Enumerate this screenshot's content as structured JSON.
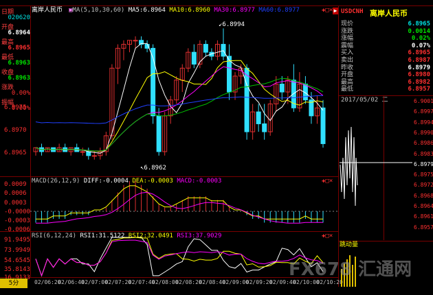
{
  "colors": {
    "up": "#e03030",
    "down": "#30e0ff",
    "ma5": "#ffffff",
    "ma10": "#ffff00",
    "ma20": "#ff00ff",
    "ma30": "#00c000",
    "ma60": "#2040ff",
    "border": "#a00000",
    "yellow": "#ffff00",
    "white": "#ffffff"
  },
  "window": {
    "title": "离岸人民币"
  },
  "ma_header": {
    "prefix": "MA(5,10,30,60)",
    "ma5": "MA5:6.8964",
    "ma10": "MA10:6.8960",
    "ma30": "MA30:6.8977",
    "ma60": "MA60:6.8977"
  },
  "left_panel": {
    "items": [
      {
        "label": "日期",
        "value": "020620"
      },
      {
        "label": "开盘",
        "value": "6.8964"
      },
      {
        "label": "最高",
        "value": "6.8965"
      },
      {
        "label": "最低",
        "value": "6.8963"
      },
      {
        "label": "收盘",
        "value": "6.8963"
      },
      {
        "label": "涨跌",
        "value": "0.00%"
      },
      {
        "label": "振幅",
        "value": "0.00%"
      }
    ]
  },
  "main_chart": {
    "price_ticks": [
      "6.8975",
      "6.8970",
      "6.8965"
    ],
    "annotations": {
      "high": "6.8994",
      "low": "6.8962"
    }
  },
  "macd": {
    "header": "MACD(26,12,9)",
    "diff": "DIFF:-0.0004",
    "dea": "DEA:-0.0003",
    "macd": "MACD:-0.0003",
    "ticks": [
      "0.0009",
      "0.0006",
      "0.0003",
      "-0.0000",
      "-0.0003",
      "-0.0006"
    ]
  },
  "rsi": {
    "header": "RSI(6,12,24)",
    "rsi1": "RSI1:31.5122",
    "rsi2": "RSI2:32.0491",
    "rsi3": "RSI3:37.9029",
    "ticks": [
      "91.9495",
      "73.9949",
      "54.6545",
      "35.8143",
      "16.9133"
    ]
  },
  "time_axis": {
    "period": "5分",
    "labels": [
      "02/06:20",
      "02/06:40",
      "02/07:00",
      "02/07:20",
      "02/07:40",
      "02/08:00",
      "02/08:20",
      "02/08:40",
      "02/09:00",
      "02/09:20",
      "02/09:40",
      "02/10:00",
      "02/10:20"
    ]
  },
  "quote_panel": {
    "symbol": "USDCNH",
    "name": "离岸人民币",
    "rows": [
      {
        "label": "现价",
        "value": "6.8965",
        "color": "#00e0e0"
      },
      {
        "label": "涨跌",
        "value": "0.0014",
        "color": "#00e000"
      },
      {
        "label": "涨幅",
        "value": "0.02%",
        "color": "#00e000"
      },
      {
        "label": "震幅",
        "value": "0.07%",
        "color": "#ffffff"
      },
      {
        "label": "买入",
        "value": "6.8965",
        "color": "#ff3030"
      },
      {
        "label": "卖出",
        "value": "6.8987",
        "color": "#ff3030"
      },
      {
        "label": "昨收",
        "value": "6.8979",
        "color": "#ffffff"
      },
      {
        "label": "开盘",
        "value": "6.8980",
        "color": "#ff3030"
      },
      {
        "label": "最高",
        "value": "6.8982",
        "color": "#ff3030"
      },
      {
        "label": "最低",
        "value": "6.8957",
        "color": "#ff3030"
      }
    ],
    "date": "2017/05/02 二",
    "mini_ticks": [
      "6.9001",
      "6.8997",
      "6.8994",
      "6.8990",
      "6.8986",
      "6.8983",
      "6.8979",
      "6.8975",
      "6.8972",
      "6.8968",
      "6.8964",
      "6.8961",
      "6.8957"
    ],
    "volume_label": "跳动量"
  },
  "watermark": "FX678 汇通网",
  "chart_data": {
    "type": "candlestick",
    "candles": [
      [
        6.8963,
        6.8964,
        6.8962,
        6.8964
      ],
      [
        6.8964,
        6.8965,
        6.8962,
        6.8963
      ],
      [
        6.8963,
        6.8964,
        6.8963,
        6.8964
      ],
      [
        6.8964,
        6.8964,
        6.8963,
        6.8963
      ],
      [
        6.8963,
        6.8965,
        6.8963,
        6.8964
      ],
      [
        6.8964,
        6.8965,
        6.8963,
        6.8963
      ],
      [
        6.8963,
        6.8964,
        6.8962,
        6.8964
      ],
      [
        6.8964,
        6.8965,
        6.8963,
        6.8963
      ],
      [
        6.8963,
        6.8964,
        6.8962,
        6.8963
      ],
      [
        6.8963,
        6.8964,
        6.8961,
        6.8962
      ],
      [
        6.8962,
        6.8963,
        6.8961,
        6.8962
      ],
      [
        6.8962,
        6.8964,
        6.8961,
        6.8963
      ],
      [
        6.8963,
        6.8968,
        6.8962,
        6.8967
      ],
      [
        6.8967,
        6.8985,
        6.8966,
        6.8984
      ],
      [
        6.8984,
        6.899,
        6.898,
        6.8989
      ],
      [
        6.8989,
        6.8991,
        6.8986,
        6.899
      ],
      [
        6.899,
        6.8991,
        6.8988,
        6.8991
      ],
      [
        6.8991,
        6.8992,
        6.8989,
        6.8991
      ],
      [
        6.8991,
        6.8992,
        6.8989,
        6.899
      ],
      [
        6.899,
        6.8991,
        6.8988,
        6.8989
      ],
      [
        6.8989,
        6.899,
        6.897,
        6.8972
      ],
      [
        6.8972,
        6.8974,
        6.8962,
        6.8963
      ],
      [
        6.8963,
        6.8973,
        6.8962,
        6.8972
      ],
      [
        6.8972,
        6.8977,
        6.897,
        6.8976
      ],
      [
        6.8976,
        6.8982,
        6.8975,
        6.8981
      ],
      [
        6.8981,
        6.8985,
        6.8978,
        6.8984
      ],
      [
        6.8984,
        6.8989,
        6.8983,
        6.8988
      ],
      [
        6.8988,
        6.899,
        6.8984,
        6.8985
      ],
      [
        6.8985,
        6.8991,
        6.8984,
        6.899
      ],
      [
        6.899,
        6.8991,
        6.8987,
        6.8988
      ],
      [
        6.8988,
        6.8989,
        6.8986,
        6.8987
      ],
      [
        6.8987,
        6.8991,
        6.8986,
        6.899
      ],
      [
        6.899,
        6.8994,
        6.8986,
        6.8987
      ],
      [
        6.8987,
        6.899,
        6.8976,
        6.8978
      ],
      [
        6.8978,
        6.8983,
        6.8976,
        6.8982
      ],
      [
        6.8982,
        6.8985,
        6.898,
        6.8984
      ],
      [
        6.8984,
        6.8985,
        6.8966,
        6.8968
      ],
      [
        6.8968,
        6.8975,
        6.8966,
        6.8973
      ],
      [
        6.8973,
        6.8975,
        6.8968,
        6.897
      ],
      [
        6.897,
        6.8975,
        6.8966,
        6.8968
      ],
      [
        6.8968,
        6.8976,
        6.8967,
        6.8975
      ],
      [
        6.8975,
        6.8982,
        6.8973,
        6.898
      ],
      [
        6.898,
        6.8982,
        6.8976,
        6.8978
      ],
      [
        6.8978,
        6.8982,
        6.8975,
        6.8981
      ],
      [
        6.8981,
        6.8985,
        6.8973,
        6.8974
      ],
      [
        6.8974,
        6.8983,
        6.8973,
        6.898
      ],
      [
        6.898,
        6.8982,
        6.8975,
        6.8976
      ],
      [
        6.8976,
        6.8978,
        6.897,
        6.8972
      ],
      [
        6.8972,
        6.8977,
        6.897,
        6.8974
      ],
      [
        6.8974,
        6.8976,
        6.8964,
        6.8965
      ]
    ],
    "macd_bars": [
      -0.0003,
      -0.0003,
      -0.0003,
      -0.0002,
      -0.0002,
      -0.0002,
      -0.0001,
      -0.0001,
      -0.0001,
      -0.0001,
      0.0,
      0.0,
      0.0001,
      0.0003,
      0.0005,
      0.0007,
      0.0008,
      0.0008,
      0.0007,
      0.0006,
      0.0004,
      0.0002,
      0.0001,
      0.0001,
      0.0002,
      0.0003,
      0.0004,
      0.0004,
      0.0004,
      0.0004,
      0.0003,
      0.0003,
      0.0003,
      0.0001,
      0.0,
      0.0,
      -0.0001,
      -0.0002,
      -0.0002,
      -0.0003,
      -0.0003,
      -0.0003,
      -0.0003,
      -0.0003,
      -0.0003,
      -0.0003,
      -0.0002,
      -0.0003,
      -0.0003,
      -0.0003
    ]
  }
}
